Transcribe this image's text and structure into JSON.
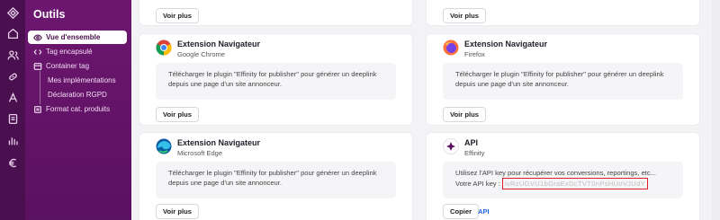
{
  "sidebar": {
    "title": "Outils",
    "items": [
      {
        "label": "Vue d'ensemble"
      },
      {
        "label": "Tag encapsulé"
      },
      {
        "label": "Container tag"
      },
      {
        "label": "Mes implémentations"
      },
      {
        "label": "Déclaration RGPD"
      },
      {
        "label": "Format cat. produits"
      }
    ]
  },
  "rail_icons": [
    "logo-icon",
    "home-icon",
    "users-icon",
    "link-icon",
    "tools-icon",
    "document-icon",
    "chart-icon",
    "euro-icon"
  ],
  "cards": {
    "top_left": {
      "button": "Voir plus"
    },
    "top_right": {
      "button": "Voir plus"
    },
    "chrome": {
      "title": "Extension Navigateur",
      "subtitle": "Google Chrome",
      "description": "Télécharger le plugin \"Effinity for publisher\" pour générer un deeplink depuis une page d'un site annonceur.",
      "button": "Voir plus"
    },
    "firefox": {
      "title": "Extension Navigateur",
      "subtitle": "Firefox",
      "description": "Télécharger le plugin \"Effinity for publisher\" pour générer un deeplink depuis une page d'un site annonceur.",
      "button": "Voir plus"
    },
    "edge": {
      "title": "Extension Navigateur",
      "subtitle": "Microsoft Edge",
      "description": "Télécharger le plugin \"Effinity for publisher\" pour générer un deeplink depuis une page d'un site annonceur.",
      "button": "Voir plus"
    },
    "api": {
      "title": "API",
      "subtitle": "Effinity",
      "description": "Utilisez l'API key pour récupérer vos conversions, reportings, etc...",
      "key_label": "Votre API key :",
      "key_value": "ivRzUGVU1bGraExDcTVT0nPsHUoVJUdY",
      "copy_button": "Copier",
      "link": "API"
    }
  },
  "colors": {
    "sidebar": "#6d1670",
    "rail": "#4a0f4f",
    "link": "#2563eb",
    "highlight": "#e11d2a"
  }
}
